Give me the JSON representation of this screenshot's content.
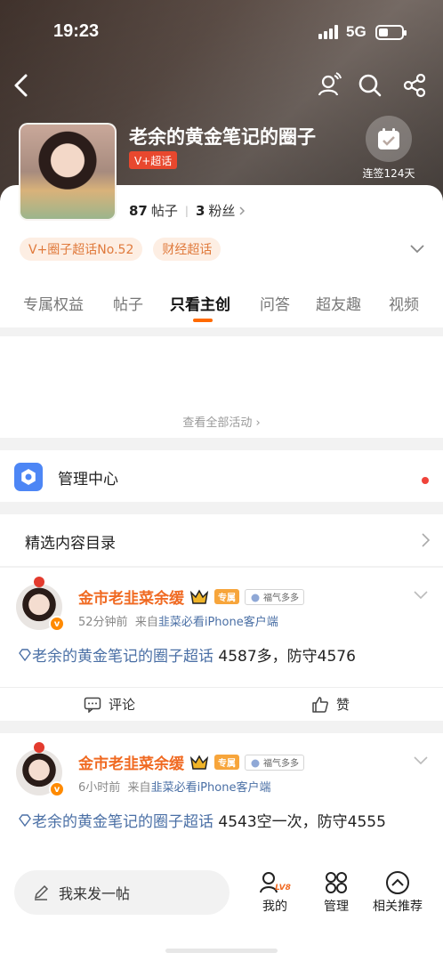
{
  "status_bar": {
    "time": "19:23",
    "network": "5G"
  },
  "header": {
    "title": "老余的黄金笔记的圈子",
    "super_badge": "V+超话",
    "checkin_label": "连签124天",
    "posts_count": "87",
    "posts_label": "帖子",
    "fans_count": "3",
    "fans_label": "粉丝"
  },
  "tags": [
    "V+圈子超话No.52",
    "财经超话"
  ],
  "tabs": [
    "专属权益",
    "帖子",
    "只看主创",
    "问答",
    "超友趣",
    "视频"
  ],
  "active_tab": "只看主创",
  "activity": {
    "view_all": "查看全部活动"
  },
  "manage": {
    "label": "管理中心"
  },
  "catalog": {
    "label": "精选内容目录"
  },
  "posts": [
    {
      "author": "金市老韭菜余缓",
      "exclusive_badge": "专属",
      "fortune_badge": "福气多多",
      "time": "52分钟前",
      "from_prefix": "来自",
      "source": "韭菜必看iPhone客户端",
      "topic": "老余的黄金笔记的圈子超话",
      "text": " 4587多，防守4576",
      "comment_label": "评论",
      "like_label": "赞"
    },
    {
      "author": "金市老韭菜余缓",
      "exclusive_badge": "专属",
      "fortune_badge": "福气多多",
      "time": "6小时前",
      "from_prefix": "来自",
      "source": "韭菜必看iPhone客户端",
      "topic": "老余的黄金笔记的圈子超话",
      "text": " 4543空一次，防守4555"
    }
  ],
  "bottom_bar": {
    "compose_placeholder": "我来发一帖",
    "level": "LV8",
    "mine": "我的",
    "manage": "管理",
    "recommend": "相关推荐"
  },
  "colors": {
    "accent": "#ff6a00",
    "topic": "#4a6fa5",
    "author": "#f06a22"
  }
}
